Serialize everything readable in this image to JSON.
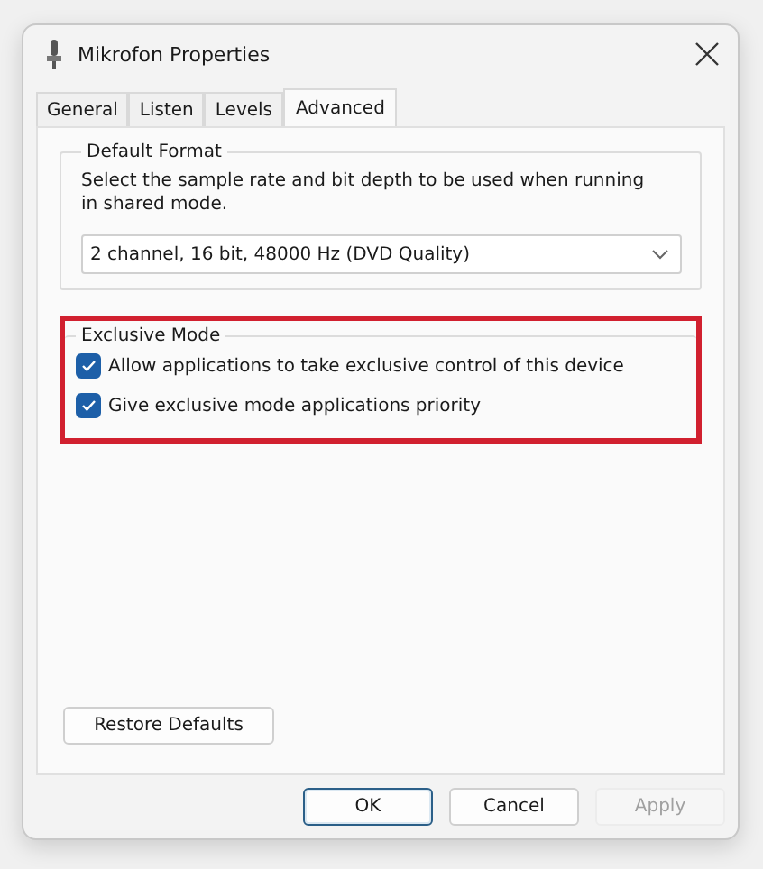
{
  "window": {
    "title": "Mikrofon Properties"
  },
  "tabs": [
    {
      "label": "General",
      "selected": false
    },
    {
      "label": "Listen",
      "selected": false
    },
    {
      "label": "Levels",
      "selected": false
    },
    {
      "label": "Advanced",
      "selected": true
    }
  ],
  "default_format": {
    "title": "Default Format",
    "description": "Select the sample rate and bit depth to be used when running in shared mode.",
    "format": "2 channel, 16 bit, 48000 Hz (DVD Quality)"
  },
  "exclusive_mode": {
    "title": "Exclusive Mode",
    "highlighted": true,
    "options": [
      {
        "label": "Allow applications to take exclusive control of this device",
        "checked": true
      },
      {
        "label": "Give exclusive mode applications priority",
        "checked": true
      }
    ]
  },
  "restore_button": "Restore Defaults",
  "buttons": [
    {
      "label": "OK",
      "default": true,
      "disabled": false
    },
    {
      "label": "Cancel",
      "default": false,
      "disabled": false
    },
    {
      "label": "Apply",
      "default": false,
      "disabled": true
    }
  ]
}
